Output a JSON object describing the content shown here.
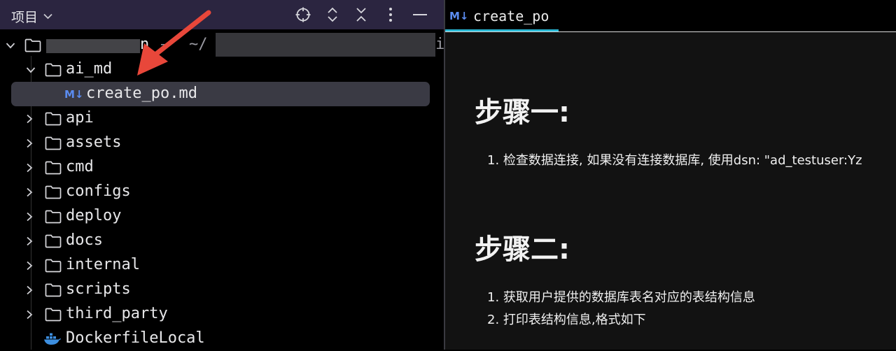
{
  "left_panel": {
    "title": "项目",
    "root": {
      "name_tail": "n",
      "separator": "—",
      "path_prefix": "~/",
      "path_tail": "i"
    },
    "items": [
      {
        "label": "ai_md",
        "kind": "folder",
        "expanded": true
      },
      {
        "label": "create_po.md",
        "kind": "markdown-file",
        "selected": true
      },
      {
        "label": "api",
        "kind": "folder"
      },
      {
        "label": "assets",
        "kind": "folder"
      },
      {
        "label": "cmd",
        "kind": "folder"
      },
      {
        "label": "configs",
        "kind": "folder"
      },
      {
        "label": "deploy",
        "kind": "folder"
      },
      {
        "label": "docs",
        "kind": "folder"
      },
      {
        "label": "internal",
        "kind": "folder"
      },
      {
        "label": "scripts",
        "kind": "folder"
      },
      {
        "label": "third_party",
        "kind": "folder"
      },
      {
        "label": "DockerfileLocal",
        "kind": "docker-file"
      }
    ],
    "md_badge": "M↓"
  },
  "editor": {
    "tab_label": "create_po",
    "md_badge": "M↓",
    "sections": [
      {
        "heading": "步骤一:",
        "items": [
          "1. 检查数据连接, 如果没有连接数据库, 使用dsn: \"ad_testuser:Yz"
        ]
      },
      {
        "heading": "步骤二:",
        "items": [
          "1. 获取用户提供的数据库表名对应的表结构信息",
          "2. 打印表结构信息,格式如下"
        ]
      }
    ]
  },
  "colors": {
    "header_bg": "#2b2540",
    "selection_bg": "#3a3a44",
    "tab_accent": "#2bbbd8",
    "markdown_badge": "#5b8cf0",
    "annotation_arrow": "#e8473a"
  }
}
